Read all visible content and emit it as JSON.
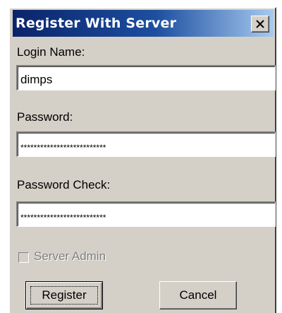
{
  "window": {
    "title": "Register With Server",
    "close_glyph": "×",
    "colors": {
      "title_start": "#0a246a",
      "title_end": "#a6caf0",
      "face": "#d4d0c8"
    }
  },
  "form": {
    "login_label": "Login Name:",
    "login_value": "dimps",
    "password_label": "Password:",
    "password_value": "**************************",
    "password_check_label": "Password Check:",
    "password_check_value": "**************************",
    "server_admin_label": "Server Admin",
    "server_admin_checked": false,
    "server_admin_enabled": false
  },
  "buttons": {
    "register_label": "Register",
    "cancel_label": "Cancel"
  },
  "icons": {
    "close": "close-icon"
  }
}
